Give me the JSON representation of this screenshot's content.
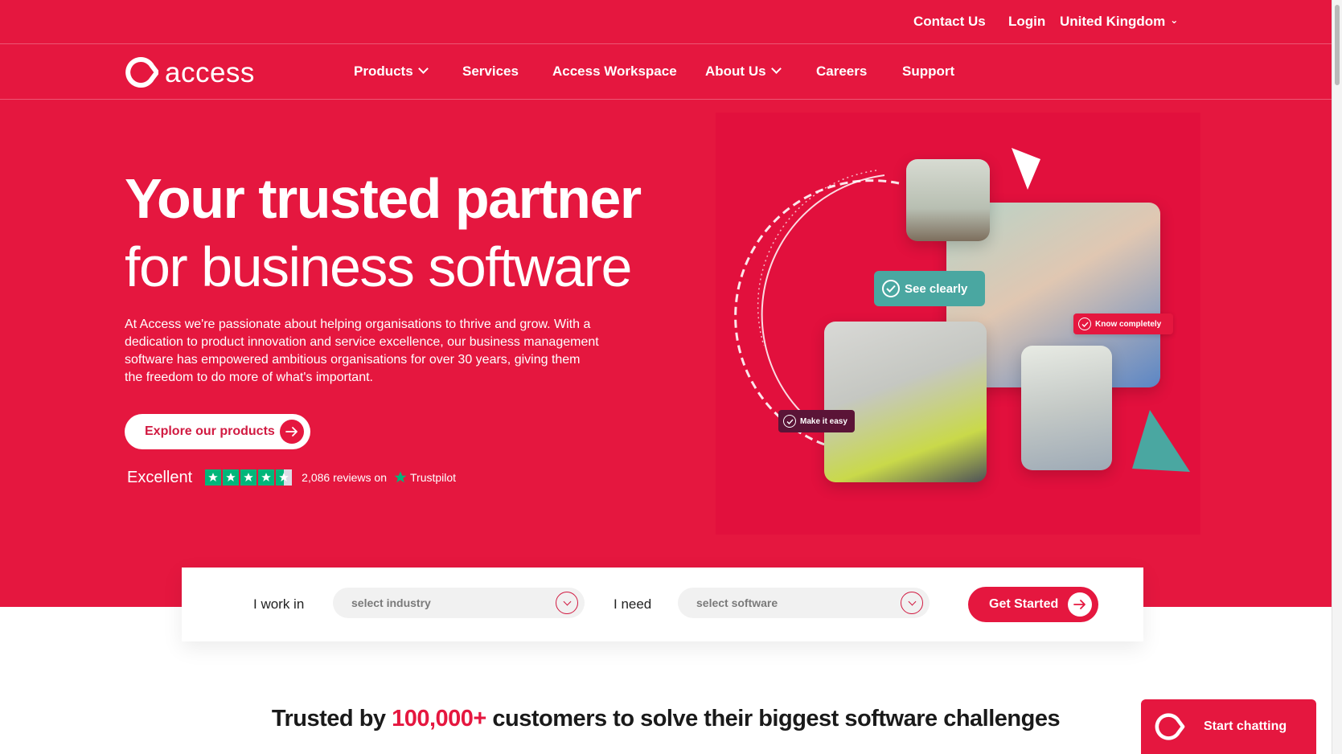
{
  "utility": {
    "contact": "Contact Us",
    "login": "Login",
    "country": "United Kingdom"
  },
  "brand": {
    "name": "access"
  },
  "nav": {
    "products": "Products",
    "services": "Services",
    "workspace": "Access Workspace",
    "about": "About Us",
    "careers": "Careers",
    "support": "Support"
  },
  "hero": {
    "title_line1": "Your trusted partner",
    "title_line2": "for business software",
    "description": "At Access we're passionate about helping organisations to thrive and grow. With a dedication to product innovation and service excellence, our business management software has empowered ambitious organisations for over 30 years, giving them the freedom to do more of what's important.",
    "cta": "Explore our products",
    "tags": {
      "see": "See clearly",
      "know": "Know completely",
      "easy": "Make it easy"
    }
  },
  "trustpilot": {
    "label": "Excellent",
    "rating_stars": 4.5,
    "reviews": "2,086 reviews on",
    "brand": "Trustpilot"
  },
  "finder": {
    "work_label": "I work in",
    "industry_placeholder": "select industry",
    "need_label": "I need",
    "software_placeholder": "select software",
    "button": "Get Started"
  },
  "trusted": {
    "before": "Trusted by ",
    "highlight": "100,000+",
    "after": " customers to solve their biggest software challenges"
  },
  "chat": {
    "label": "Start chatting"
  },
  "colors": {
    "brand_red": "#e5173f",
    "teal": "#4aa7a1",
    "trustpilot_green": "#00b67a",
    "plum": "#5b1437"
  }
}
